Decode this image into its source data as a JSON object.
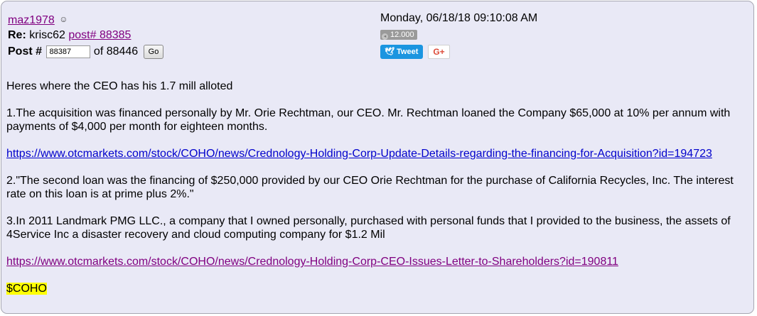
{
  "header": {
    "username": "maz1978",
    "user_icon": "face-icon",
    "re_label": "Re:",
    "re_user": "krisc62",
    "re_post_link": "post# 88385",
    "post_label": "Post #",
    "post_number": "88387",
    "of_text": "of 88446",
    "go_label": "Go"
  },
  "meta": {
    "date": "Monday, 06/18/18 09:10:08 AM",
    "views": "12.000",
    "tweet_label": "Tweet",
    "gplus_label": "G+"
  },
  "body": {
    "p1": "Heres where the CEO has his 1.7 mill alloted",
    "p2": "1.The acquisition was financed personally by Mr. Orie Rechtman, our CEO. Mr. Rechtman loaned the Company $65,000 at 10% per annum with payments of $4,000 per month for eighteen months.",
    "link1": "https://www.otcmarkets.com/stock/COHO/news/Crednology-Holding-Corp-Update-Details-regarding-the-financing-for-Acquisition?id=194723",
    "p3": "2.\"The second loan was the financing of $250,000 provided by our CEO Orie Rechtman for the purchase of California Recycles, Inc. The interest rate on this loan is at prime plus 2%.\"",
    "p4": "3.In 2011 Landmark PMG LLC., a company that I owned personally, purchased with personal funds that I provided to the business, the assets of 4Service Inc a disaster recovery and cloud computing company for $1.2 Mil",
    "link2": "https://www.otcmarkets.com/stock/COHO/news/Crednology-Holding-Corp-CEO-Issues-Letter-to-Shareholders?id=190811",
    "ticker": "$COHO"
  },
  "colors": {
    "panel_bg": "#e9e9f6",
    "visited_link": "#800080",
    "link": "#0000cc",
    "tweet": "#1b95e0",
    "highlight": "#ffff00"
  }
}
